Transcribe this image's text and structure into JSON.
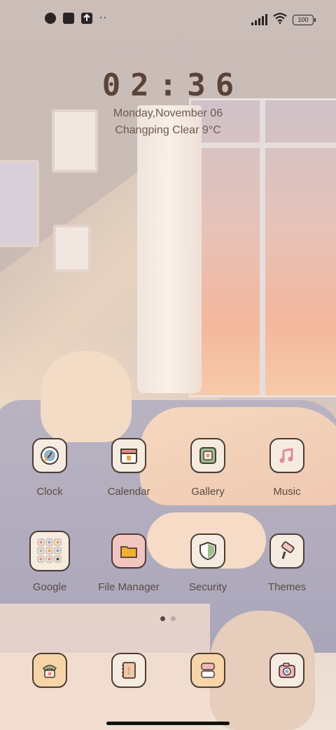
{
  "status_bar": {
    "left_icons": [
      "whatsapp-icon",
      "notification-square-icon",
      "upload-icon",
      "more-dots-icon"
    ],
    "more_dots": "··",
    "battery": "100"
  },
  "clock_widget": {
    "time": "02:36",
    "date": "Monday,November 06",
    "weather": "Changping Clear 9°C"
  },
  "apps_row1": [
    {
      "label": "Clock",
      "icon": "clock-icon"
    },
    {
      "label": "Calendar",
      "icon": "calendar-icon"
    },
    {
      "label": "Gallery",
      "icon": "gallery-icon"
    },
    {
      "label": "Music",
      "icon": "music-icon"
    }
  ],
  "apps_row2": [
    {
      "label": "Google",
      "icon": "google-folder-icon"
    },
    {
      "label": "File Manager",
      "icon": "folder-icon"
    },
    {
      "label": "Security",
      "icon": "shield-icon"
    },
    {
      "label": "Themes",
      "icon": "paint-roller-icon"
    }
  ],
  "dock": [
    {
      "icon": "phone-icon"
    },
    {
      "icon": "contacts-book-icon"
    },
    {
      "icon": "messages-icon"
    },
    {
      "icon": "camera-icon"
    }
  ],
  "page_indicator": {
    "pages": 2,
    "active": 1
  },
  "colors": {
    "icon_tile_bg": "#f6ebe0",
    "icon_outline": "#4d3d36",
    "label_text": "#5b4a43"
  }
}
